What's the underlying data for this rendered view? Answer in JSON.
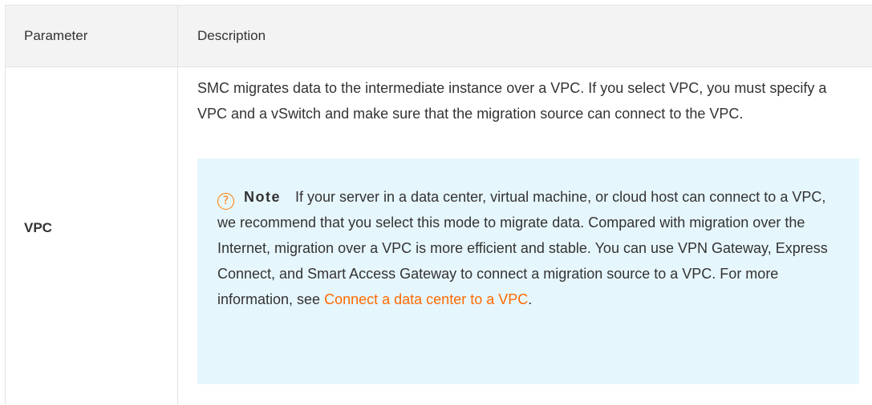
{
  "table": {
    "headers": {
      "parameter": "Parameter",
      "description": "Description"
    },
    "rows": [
      {
        "parameter": "VPC",
        "description": "SMC migrates data to the intermediate instance over a VPC. If you select VPC, you must specify a VPC and a vSwitch and make sure that the migration source can connect to the VPC.",
        "note": {
          "icon": "question-circle-icon",
          "title": "Note",
          "text": "If your server in a data center, virtual machine, or cloud host can connect to a VPC, we recommend that you select this mode to migrate data. Compared with migration over the Internet, migration over a VPC is more efficient and stable. You can use VPN Gateway, Express Connect, and Smart Access Gateway to connect a migration source to a VPC. For more information, see ",
          "link_text": "Connect a data center to a VPC",
          "trailing": "."
        }
      }
    ]
  },
  "colors": {
    "header_bg": "#f3f3f3",
    "border": "#e4e4e4",
    "note_bg": "#e6f6fd",
    "accent": "#ff6a00",
    "text": "#333333"
  }
}
